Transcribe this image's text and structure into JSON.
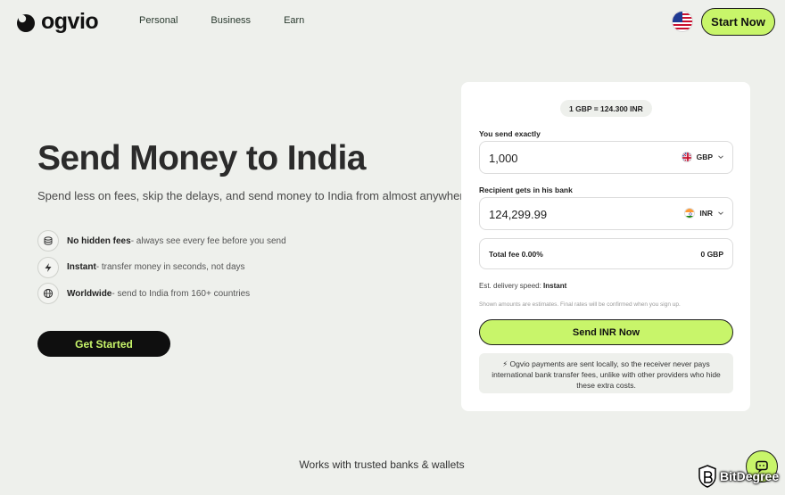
{
  "header": {
    "logo_text": "ogvio",
    "nav": [
      "Personal",
      "Business",
      "Earn"
    ],
    "start_label": "Start Now"
  },
  "hero": {
    "title": "Send Money to India",
    "subtitle": "Spend less on fees, skip the delays, and send money to India from almost anywhere.",
    "features": [
      {
        "icon": "coins-icon",
        "bold": "No hidden fees",
        "text": " - always see every fee before you send"
      },
      {
        "icon": "lightning-icon",
        "bold": "Instant",
        "text": " - transfer money in seconds, not days"
      },
      {
        "icon": "globe-icon",
        "bold": "Worldwide",
        "text": " - send to India from 160+ countries"
      }
    ],
    "cta": "Get Started"
  },
  "converter": {
    "rate": "1 GBP = 124.300 INR",
    "send_label": "You send exactly",
    "send_amount": "1,000",
    "send_currency": "GBP",
    "receive_label": "Recipient gets in his bank",
    "receive_amount": "124,299.99",
    "receive_currency": "INR",
    "fee_label": "Total fee 0.00%",
    "fee_value": "0 GBP",
    "delivery_label": "Est. delivery speed:",
    "delivery_value": "Instant",
    "disclaimer": "Shown amounts are estimates. Final rates will be confirmed when you sign up.",
    "send_button": "Send INR Now",
    "note": "⚡ Ogvio payments are sent locally, so the receiver never pays international bank transfer fees, unlike with other providers who hide these extra costs."
  },
  "footer": {
    "trusted": "Works with trusted banks & wallets",
    "watermark": "BitDegree"
  },
  "colors": {
    "background": "#eef0ec",
    "accent": "#c8f56a",
    "dark": "#0f0f0f"
  }
}
